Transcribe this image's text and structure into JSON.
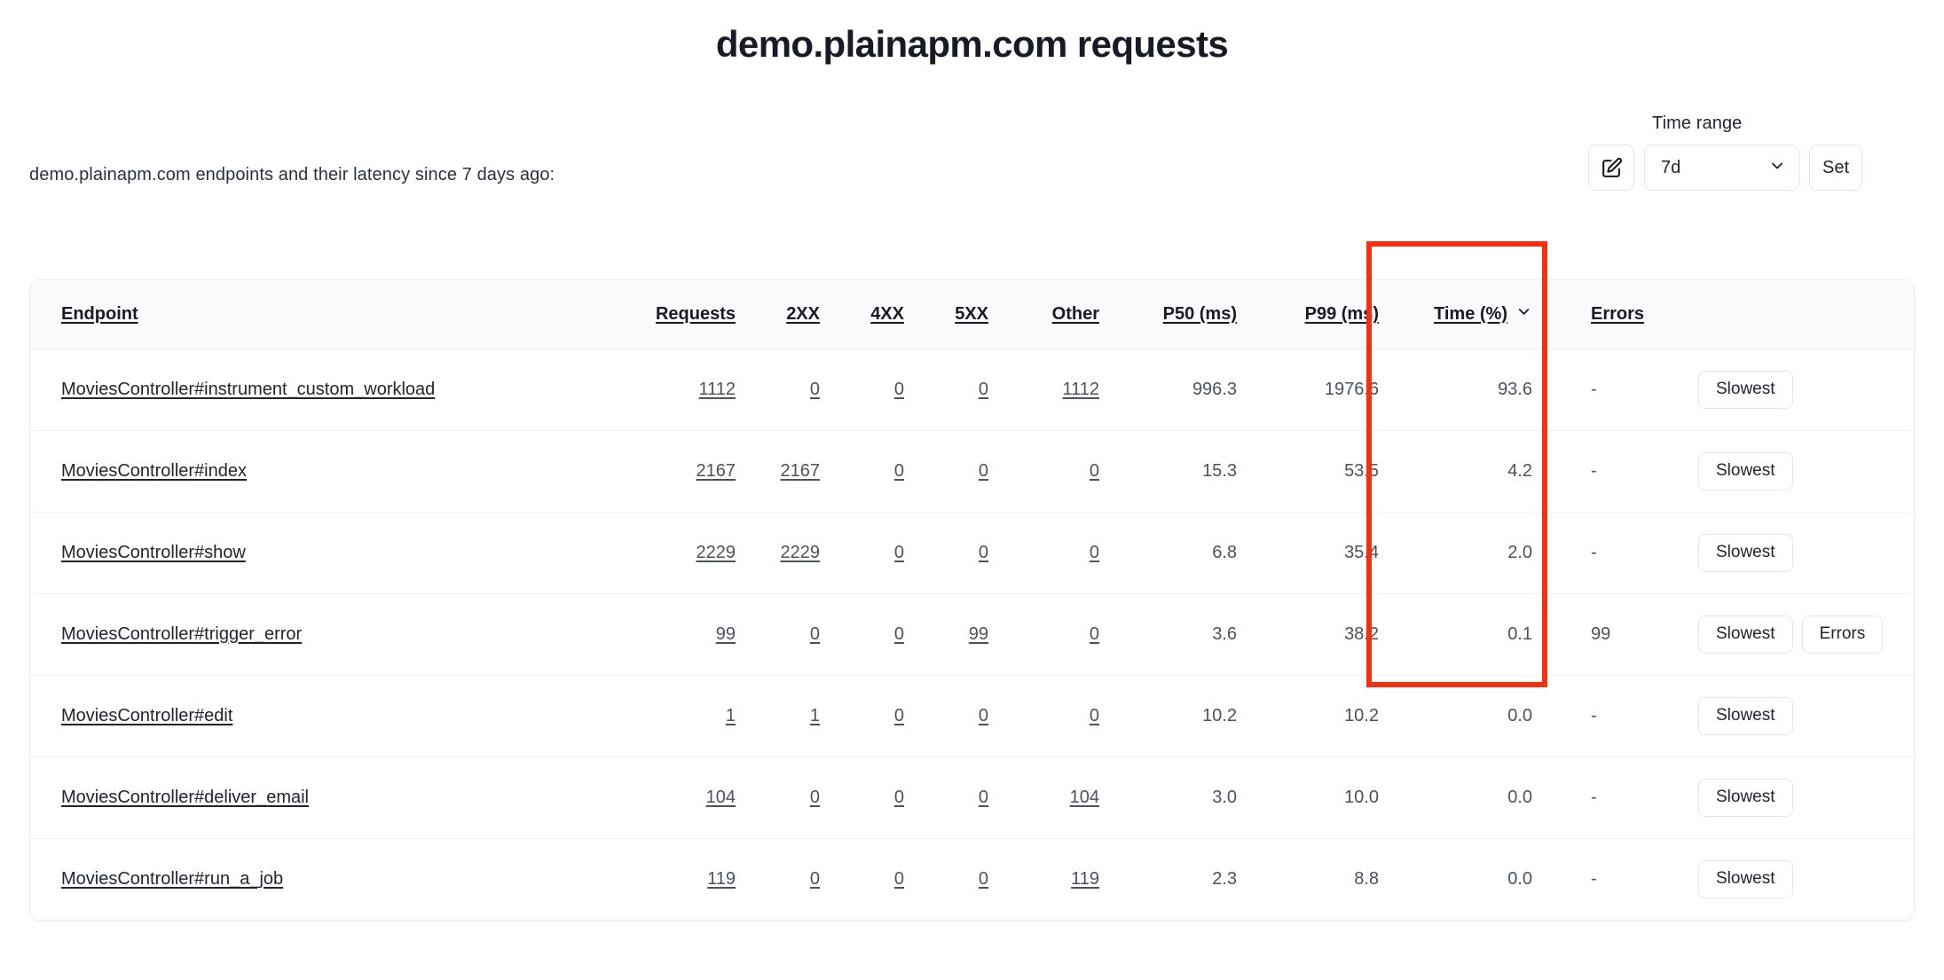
{
  "header": {
    "title": "demo.plainapm.com requests",
    "subtitle": "demo.plainapm.com endpoints and their latency since 7 days ago:"
  },
  "time_range": {
    "label": "Time range",
    "edit_icon": "edit-pencil-square-icon",
    "selected": "7d",
    "chevron_icon": "chevron-down-icon",
    "set_label": "Set"
  },
  "table": {
    "columns": [
      {
        "key": "endpoint",
        "label": "Endpoint",
        "sorted": false
      },
      {
        "key": "requests",
        "label": "Requests",
        "sorted": false
      },
      {
        "key": "c2xx",
        "label": "2XX",
        "sorted": false
      },
      {
        "key": "c4xx",
        "label": "4XX",
        "sorted": false
      },
      {
        "key": "c5xx",
        "label": "5XX",
        "sorted": false
      },
      {
        "key": "other",
        "label": "Other",
        "sorted": false
      },
      {
        "key": "p50",
        "label": "P50 (ms)",
        "sorted": false
      },
      {
        "key": "p99",
        "label": "P99 (ms)",
        "sorted": false
      },
      {
        "key": "time_pct",
        "label": "Time (%)",
        "sorted": true,
        "sort_icon": "chevron-down-icon"
      },
      {
        "key": "errors",
        "label": "Errors",
        "sorted": false
      },
      {
        "key": "actions",
        "label": "",
        "sorted": false
      }
    ],
    "rows": [
      {
        "endpoint": "MoviesController#instrument_custom_workload",
        "requests": "1112",
        "c2xx": "0",
        "c4xx": "0",
        "c5xx": "0",
        "other": "1112",
        "p50": "996.3",
        "p99": "1976.6",
        "time_pct": "93.6",
        "errors": "-",
        "actions": [
          "Slowest"
        ]
      },
      {
        "endpoint": "MoviesController#index",
        "requests": "2167",
        "c2xx": "2167",
        "c4xx": "0",
        "c5xx": "0",
        "other": "0",
        "p50": "15.3",
        "p99": "53.5",
        "time_pct": "4.2",
        "errors": "-",
        "actions": [
          "Slowest"
        ]
      },
      {
        "endpoint": "MoviesController#show",
        "requests": "2229",
        "c2xx": "2229",
        "c4xx": "0",
        "c5xx": "0",
        "other": "0",
        "p50": "6.8",
        "p99": "35.4",
        "time_pct": "2.0",
        "errors": "-",
        "actions": [
          "Slowest"
        ]
      },
      {
        "endpoint": "MoviesController#trigger_error",
        "requests": "99",
        "c2xx": "0",
        "c4xx": "0",
        "c5xx": "99",
        "other": "0",
        "p50": "3.6",
        "p99": "38.2",
        "time_pct": "0.1",
        "errors": "99",
        "actions": [
          "Slowest",
          "Errors"
        ]
      },
      {
        "endpoint": "MoviesController#edit",
        "requests": "1",
        "c2xx": "1",
        "c4xx": "0",
        "c5xx": "0",
        "other": "0",
        "p50": "10.2",
        "p99": "10.2",
        "time_pct": "0.0",
        "errors": "-",
        "actions": [
          "Slowest"
        ]
      },
      {
        "endpoint": "MoviesController#deliver_email",
        "requests": "104",
        "c2xx": "0",
        "c4xx": "0",
        "c5xx": "0",
        "other": "104",
        "p50": "3.0",
        "p99": "10.0",
        "time_pct": "0.0",
        "errors": "-",
        "actions": [
          "Slowest"
        ]
      },
      {
        "endpoint": "MoviesController#run_a_job",
        "requests": "119",
        "c2xx": "0",
        "c4xx": "0",
        "c5xx": "0",
        "other": "119",
        "p50": "2.3",
        "p99": "8.8",
        "time_pct": "0.0",
        "errors": "-",
        "actions": [
          "Slowest"
        ]
      }
    ]
  },
  "annotation": {
    "name": "time-percent-column-highlight",
    "color": "#f43010"
  },
  "colors": {
    "text_primary": "#161b26",
    "text_secondary": "#4a5160",
    "header_bg": "#f8fafb",
    "border": "#ebedf0",
    "annotation_red": "#f43010"
  }
}
